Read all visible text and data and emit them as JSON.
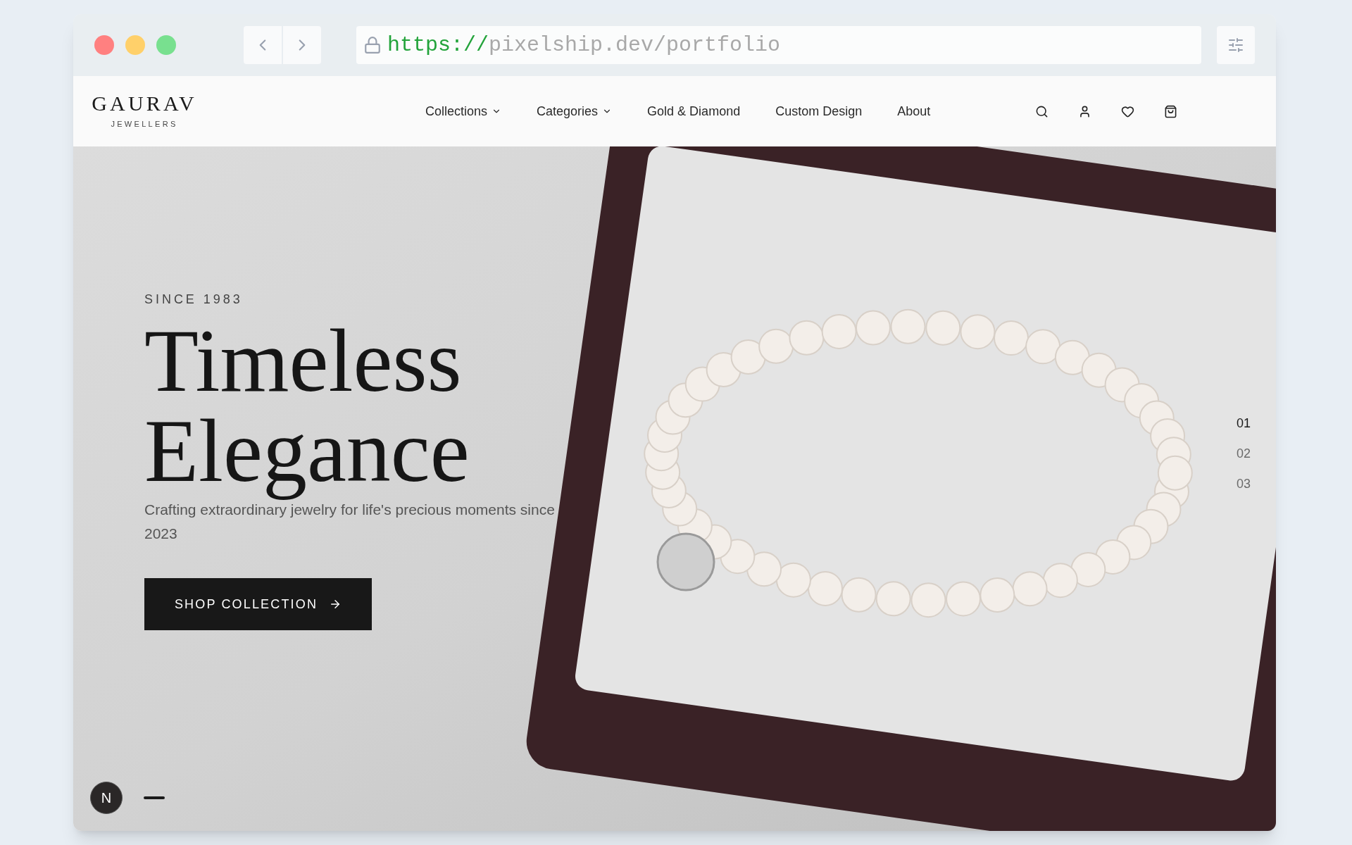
{
  "browser": {
    "url_scheme": "https://",
    "url_rest": "pixelship.dev/portfolio"
  },
  "brand": {
    "name": "GAURAV",
    "tagline": "JEWELLERS"
  },
  "nav": [
    {
      "label": "Collections",
      "dropdown": true
    },
    {
      "label": "Categories",
      "dropdown": true
    },
    {
      "label": "Gold & Diamond",
      "dropdown": false
    },
    {
      "label": "Custom Design",
      "dropdown": false
    },
    {
      "label": "About",
      "dropdown": false
    }
  ],
  "hero": {
    "eyebrow": "SINCE 1983",
    "title_lines": [
      "Timeless",
      "Elegance"
    ],
    "subtitle": "Crafting extraordinary jewelry for life's precious moments since 2023",
    "cta": "SHOP COLLECTION"
  },
  "slides": [
    {
      "label": "01",
      "selected": true
    },
    {
      "label": "02",
      "selected": false
    },
    {
      "label": "03",
      "selected": false
    }
  ],
  "dev_badge": "N"
}
